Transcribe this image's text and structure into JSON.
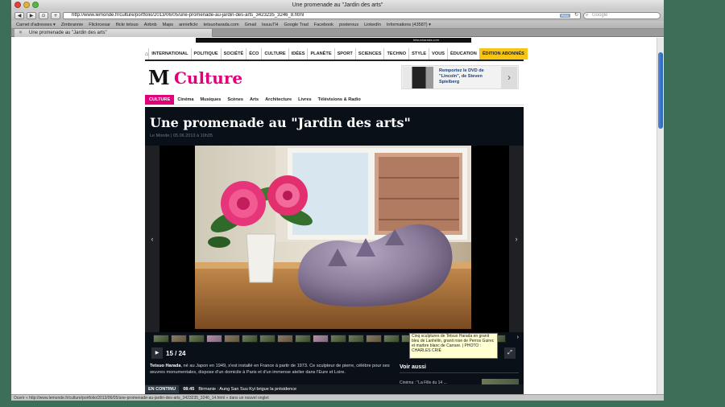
{
  "window": {
    "title": "Une promenade au \"Jardin des arts\""
  },
  "toolbar": {
    "back": "◀",
    "forward": "▶",
    "history": "⊙",
    "add": "+",
    "url": "http://www.lemonde.fr/culture/portfolio/2013/06/05/une-promenade-au-jardin-des-arts_3423235_3246_8.html",
    "rss": "RSS",
    "reload": "↻",
    "search_placeholder": "Google"
  },
  "bookmarks": [
    "Carnet d'adresses ▾",
    "Zimbrannie",
    "Flickrcesar",
    "flickr tetsuo",
    "Airbnb",
    "Maps",
    "anniefickr",
    "tetsuoharada.com",
    "Gmail",
    "IssuuTH",
    "Google Trad",
    "Facebook",
    "posterous",
    "LinkedIn",
    "Informations (43587) ▾"
  ],
  "tab": {
    "label": "Une promenade au \"Jardin des arts\"",
    "close": "✕"
  },
  "ad": {
    "label": "tetsuoharada.com"
  },
  "topnav": {
    "home": "⌂",
    "items": [
      "INTERNATIONAL",
      "POLITIQUE",
      "SOCIÉTÉ",
      "ÉCO",
      "CULTURE",
      "IDÉES",
      "PLANÈTE",
      "SPORT",
      "SCIENCES",
      "TECHNO",
      "STYLE",
      "VOUS",
      "ÉDUCATION"
    ],
    "abonnes": "ÉDITION ABONNÉS"
  },
  "header": {
    "logo": "M",
    "section": "Culture",
    "promo": {
      "text": "Remportez le DVD de \"Lincoln\", de Steven Spielberg",
      "arrow": "›"
    }
  },
  "subnav": {
    "current": "CULTURE",
    "items": [
      "Cinéma",
      "Musiques",
      "Scènes",
      "Arts",
      "Architecture",
      "Livres",
      "Télévisions & Radio"
    ]
  },
  "article": {
    "title": "Une promenade au \"Jardin des arts\"",
    "byline": "Le Monde | 05.06.2013 à 10h35",
    "prev": "‹",
    "next": "›",
    "thumb_next": "›",
    "play": "▶",
    "counter": "15 / 24",
    "expand": "⤢",
    "tooltip": "Cinq sculptures de Tetsuo Harada en granit bleu de Lanhélin, granit rose de Perros Guirec et marbre blanc de Carrare. | PHOTO : CHARLES CRIÉ",
    "caption_name": "Tetsuo Harada",
    "caption_text": ", né au Japon en 1949, s'est installé en France à partir de 1973. Ce sculpteur de pierre, célèbre pour ses œuvres monumentales, dispose d'un domicile à Paris et d'un immense atelier dans l'Eure et Loire.",
    "voir_aussi": "Voir aussi",
    "voir_item": "Cinéma : \"La Fille du 14 ..."
  },
  "ticker": {
    "tag": "EN CONTINU",
    "time": "08:45",
    "text": "Birmanie : Aung San Suu Kyi brigue la présidence"
  },
  "status": {
    "text": "Ouvrir « http://www.lemonde.fr/culture/portfolio/2013/06/05/une-promenade-au-jardin-des-arts_3423235_3246_14.html » dans un nouvel onglet"
  }
}
